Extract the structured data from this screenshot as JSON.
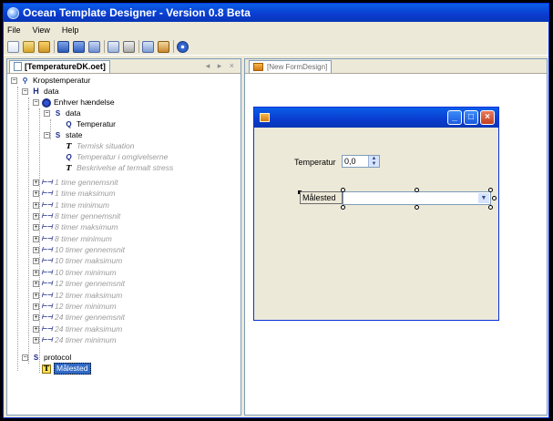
{
  "window": {
    "title": "Ocean Template Designer - Version 0.8 Beta"
  },
  "menu": [
    "File",
    "View",
    "Help"
  ],
  "toolbar_icons": [
    "new-icon",
    "open-icon",
    "open-folder-icon",
    "save-icon",
    "save-all-icon",
    "edit-icon",
    "view-icon",
    "print-icon",
    "build-icon",
    "properties-icon",
    "help-icon"
  ],
  "left_panel": {
    "tab": "[TemperatureDK.oet]",
    "nav": "◂ ▸ ×"
  },
  "right_panel": {
    "tab": "[New FormDesign]"
  },
  "tree": {
    "root": "Kropstemperatur",
    "data": "data",
    "event": "Enhver hændelse",
    "event_data": "data",
    "temperatur": "Temperatur",
    "state": "state",
    "state_items": [
      "Termisk situation",
      "Temperatur i omgivelserne",
      "Beskrivelse af termalt stress"
    ],
    "intervals": [
      "1 time gennemsnit",
      "1 time maksimum",
      "1 time minimum",
      "8 timer gennemsnit",
      "8 timer maksimum",
      "8 timer minimum",
      "10 timer gennemsnit",
      "10 timer maksimum",
      "10 timer minimum",
      "12 timer gennemsnit",
      "12 timer maksimum",
      "12 timer minimum",
      "24 timer gennemsnit",
      "24 timer maksimum",
      "24 timer minimum"
    ],
    "protocol": "protocol",
    "selected": "Målested"
  },
  "form": {
    "temperatur_label": "Temperatur",
    "temperatur_value": "0,0",
    "malested_label": "Målested"
  }
}
